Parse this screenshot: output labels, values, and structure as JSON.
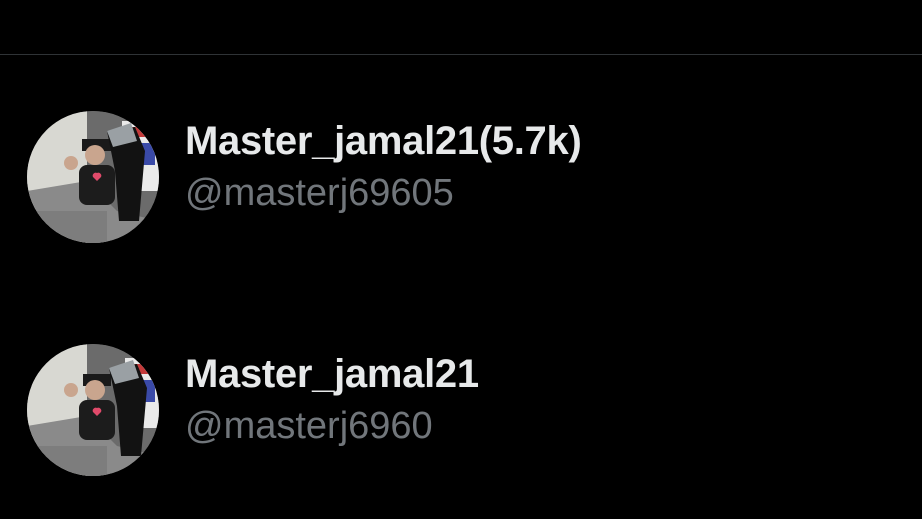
{
  "users": [
    {
      "display_name": "Master_jamal21(5.7k)",
      "handle": "@masterj69605",
      "avatar_icon": "profile-photo"
    },
    {
      "display_name": "Master_jamal21",
      "handle": "@masterj6960",
      "avatar_icon": "profile-photo"
    }
  ],
  "colors": {
    "background": "#000000",
    "name_text": "#e7e9ea",
    "handle_text": "#71767b",
    "divider": "#2f3336"
  }
}
